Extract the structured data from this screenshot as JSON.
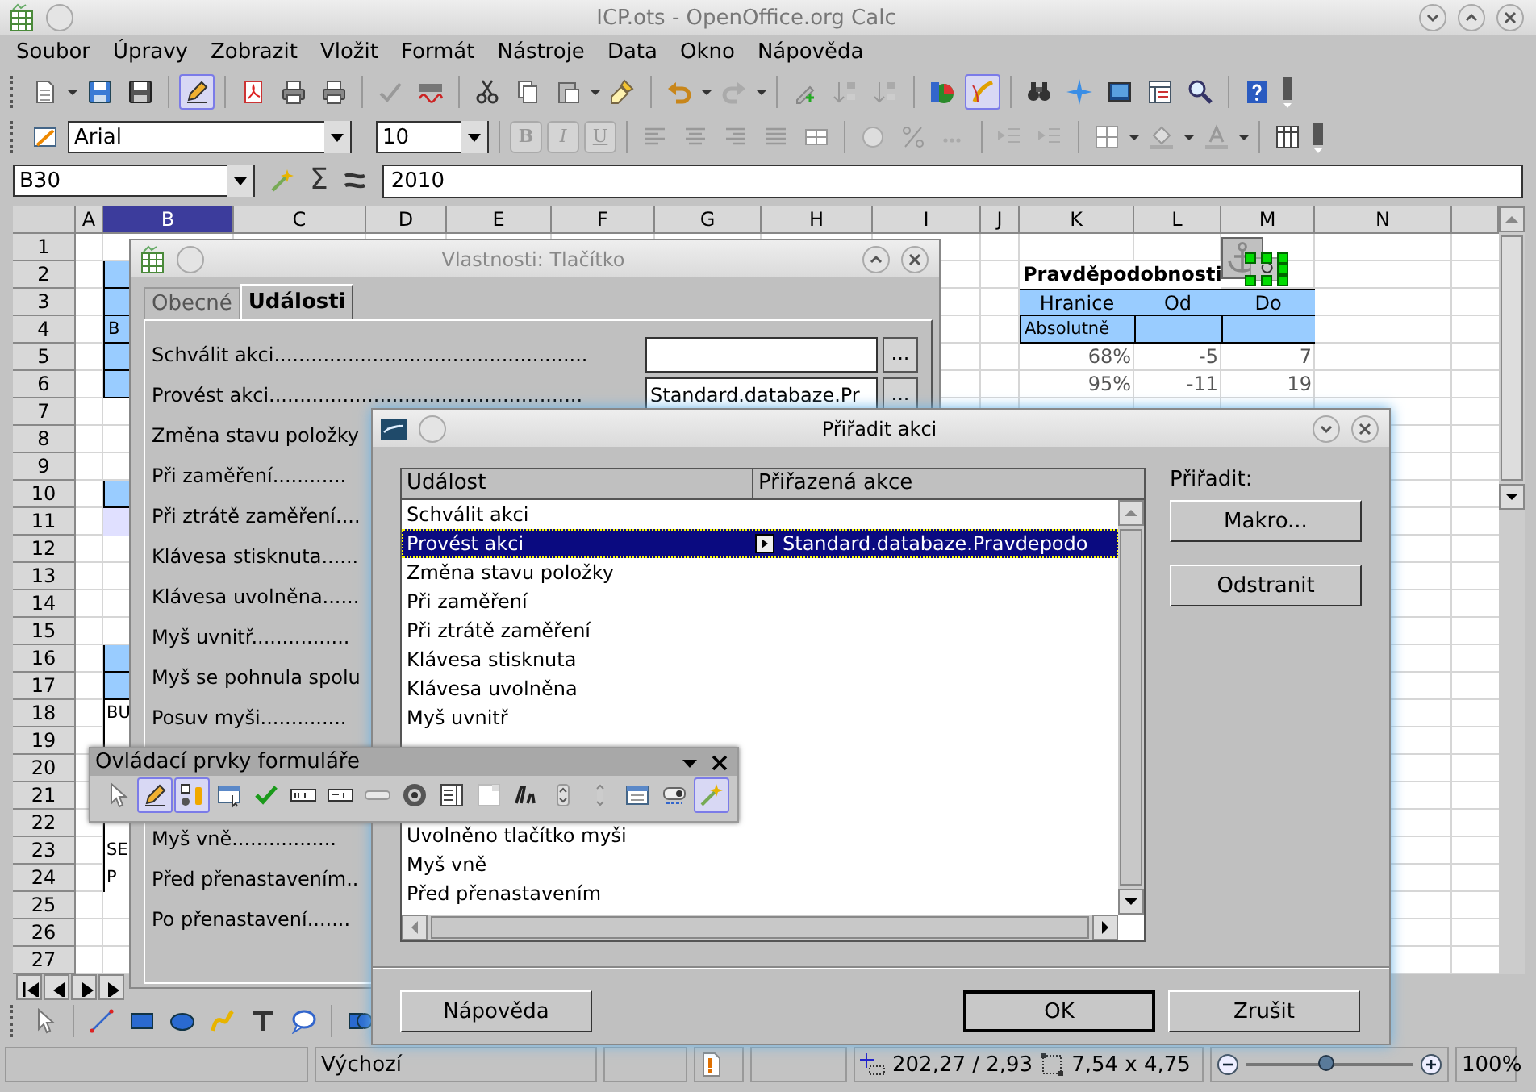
{
  "window": {
    "title": "ICP.ots - OpenOffice.org Calc"
  },
  "menu": [
    "Soubor",
    "Úpravy",
    "Zobrazit",
    "Vložit",
    "Formát",
    "Nástroje",
    "Data",
    "Okno",
    "Nápověda"
  ],
  "standard_toolbar": {
    "edit_file_on": true,
    "draw_functions_on": true
  },
  "format_toolbar": {
    "font": "Arial",
    "size": "10",
    "style_buttons": [
      "B",
      "I",
      "U"
    ]
  },
  "formula_bar": {
    "cell": "B30",
    "sum_symbol": "Σ",
    "value": "2010"
  },
  "sheet": {
    "columns": [
      {
        "label": "A",
        "selected": false
      },
      {
        "label": "B",
        "selected": true
      },
      {
        "label": "C",
        "selected": false
      },
      {
        "label": "D",
        "selected": false
      },
      {
        "label": "E",
        "selected": false
      },
      {
        "label": "F",
        "selected": false
      },
      {
        "label": "G",
        "selected": false
      },
      {
        "label": "H",
        "selected": false
      },
      {
        "label": "I",
        "selected": false
      },
      {
        "label": "J",
        "selected": false
      },
      {
        "label": "K",
        "selected": false
      },
      {
        "label": "L",
        "selected": false
      },
      {
        "label": "M",
        "selected": false
      },
      {
        "label": "N",
        "selected": false
      }
    ],
    "rows": [
      {
        "number": "1"
      },
      {
        "number": "2",
        "cells": {
          "B": {
            "kind": "band"
          },
          "K": {
            "text": "Pravděpodobnosti",
            "kind": "title"
          }
        }
      },
      {
        "number": "3",
        "cells": {
          "B": {
            "kind": "band"
          },
          "K": {
            "text": "Hranice",
            "kind": "head"
          },
          "L": {
            "text": "Od",
            "kind": "head"
          },
          "M": {
            "text": "Do",
            "kind": "head"
          }
        }
      },
      {
        "number": "4",
        "cells": {
          "B": {
            "text": "B",
            "kind": "band"
          },
          "K": {
            "text": "Absolutně",
            "kind": "band"
          },
          "L": {
            "kind": "band"
          },
          "M": {
            "kind": "band"
          }
        }
      },
      {
        "number": "5",
        "cells": {
          "B": {
            "kind": "band"
          },
          "K": {
            "text": "68%",
            "kind": "value"
          },
          "L": {
            "text": "-5",
            "kind": "value"
          },
          "M": {
            "text": "7",
            "kind": "value"
          }
        }
      },
      {
        "number": "6",
        "cells": {
          "B": {
            "kind": "band"
          },
          "K": {
            "text": "95%",
            "kind": "value"
          },
          "L": {
            "text": "-11",
            "kind": "value"
          },
          "M": {
            "text": "19",
            "kind": "value"
          }
        }
      },
      {
        "number": "7"
      },
      {
        "number": "8"
      },
      {
        "number": "9"
      },
      {
        "number": "10",
        "cells": {
          "B": {
            "kind": "band"
          }
        }
      },
      {
        "number": "11",
        "cells": {
          "B": {
            "kind": "pale"
          }
        }
      },
      {
        "number": "12"
      },
      {
        "number": "13"
      },
      {
        "number": "14"
      },
      {
        "number": "15"
      },
      {
        "number": "16",
        "cells": {
          "B": {
            "kind": "band"
          }
        }
      },
      {
        "number": "17",
        "cells": {
          "B": {
            "kind": "band"
          }
        }
      },
      {
        "number": "18",
        "cells": {
          "B": {
            "text": "BU",
            "kind": "boxed"
          }
        }
      },
      {
        "number": "19",
        "cells": {
          "B": {
            "kind": "boxed"
          }
        }
      },
      {
        "number": "20"
      },
      {
        "number": "21"
      },
      {
        "number": "22",
        "cells": {
          "B": {
            "kind": "boxed"
          }
        }
      },
      {
        "number": "23",
        "cells": {
          "B": {
            "text": "SE",
            "kind": "boxed"
          }
        }
      },
      {
        "number": "24",
        "cells": {
          "B": {
            "text": "P",
            "kind": "boxed"
          }
        }
      },
      {
        "number": "25"
      },
      {
        "number": "26"
      },
      {
        "number": "27"
      }
    ]
  },
  "properties_dialog": {
    "title": "Vlastnosti: Tlačítko",
    "tabs": [
      {
        "label": "Obecné",
        "selected": false
      },
      {
        "label": "Události",
        "selected": true
      }
    ],
    "events": [
      {
        "label": "Schválit akci...................................................",
        "button": "..."
      },
      {
        "label": "Provést akci...................................................",
        "field": "Standard.databaze.Pr",
        "button": "..."
      },
      {
        "label": "Změna stavu položky"
      },
      {
        "label": "Při zaměření............"
      },
      {
        "label": "Při ztrátě zaměření...."
      },
      {
        "label": "Klávesa stisknuta......"
      },
      {
        "label": "Klávesa uvolněna......"
      },
      {
        "label": "Myš uvnitř................"
      },
      {
        "label": "Myš se pohnula spolu"
      },
      {
        "label": "Posuv myši.............."
      }
    ],
    "events_below": [
      {
        "label": "Myš vně................."
      },
      {
        "label": "Před přenastavením.."
      },
      {
        "label": "Po přenastavení......."
      }
    ]
  },
  "assign_dialog": {
    "title": "Přiřadit akci",
    "columns": [
      "Událost",
      "Přiřazená akce"
    ],
    "rows": [
      {
        "event": "Schválit akci",
        "selected": false
      },
      {
        "event": "Provést akci",
        "action": "Standard.databaze.Pravdepodo",
        "selected": true
      },
      {
        "event": "Změna stavu položky",
        "selected": false
      },
      {
        "event": "Při zaměření",
        "selected": false
      },
      {
        "event": "Při ztrátě zaměření",
        "selected": false
      },
      {
        "event": "Klávesa stisknuta",
        "selected": false
      },
      {
        "event": "Klávesa uvolněna",
        "selected": false
      },
      {
        "event": "Myš uvnitř",
        "selected": false
      }
    ],
    "rows_below": [
      {
        "event": "Uvolněno tlačítko myši",
        "selected": false
      },
      {
        "event": "Myš vně",
        "selected": false
      },
      {
        "event": "Před přenastavením",
        "selected": false
      }
    ],
    "assign_label": "Přiřadit:",
    "side_buttons": [
      "Makro...",
      "Odstranit"
    ],
    "help_button": "Nápověda",
    "ok_button": "OK",
    "cancel_button": "Zrušit"
  },
  "form_toolbar": {
    "title": "Ovládací prvky formuláře",
    "design_mode_on": true,
    "wizards_on": true
  },
  "status_bar": {
    "page_style": "Výchozí",
    "position": "202,27 / 2,93",
    "size": "7,54 x 4,75",
    "zoom": {
      "level": 0.48
    },
    "zoom_text": "100%"
  }
}
